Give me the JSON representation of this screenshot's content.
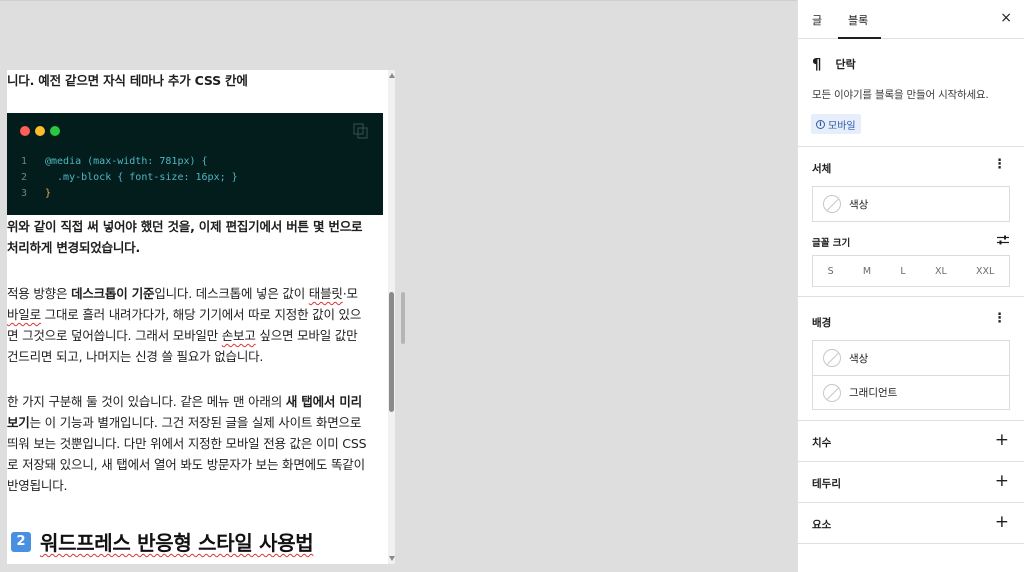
{
  "editor": {
    "line_top": "니다. 예전 같으면 자식 테마나 추가 CSS 칸에",
    "code": {
      "lines": [
        {
          "num": "1",
          "kw": "@media",
          "rest": " (max-width: 781px) {"
        },
        {
          "num": "2",
          "text": "  .my-block { font-size: 16px; }"
        },
        {
          "num": "3",
          "text": "}"
        }
      ]
    },
    "para1": {
      "line1": "위와 같이 직접 써 넣어야 했던 것을, 이제 편집기에서 버튼 몇 번으로",
      "line2": "처리하게 변경되었습니다."
    },
    "para2": {
      "l1_a": "적용 방향은 ",
      "l1_b": "데스크톱이 기준",
      "l1_c": "입니다. 데스크톱에 넣은 값이 ",
      "l1_d": "태블릿",
      "l1_e": "·모",
      "l2_a": "바일로",
      "l2_b": " 그대로 흘러 내려가다가, 해당 기기에서 따로 지정한 값이 있으",
      "l3": "면 그것으로 덮어씁니다. 그래서 모바일만 ",
      "l3_b": "손보고",
      "l3_c": " 싶으면 모바일 값만",
      "l4": "건드리면 되고, 나머지는 신경 쓸 필요가 없습니다."
    },
    "para3": {
      "l1_a": "한 가지 구분해 둘 것이 있습니다. 같은 메뉴 맨 아래의 ",
      "l1_b": "새 탭에서 미리",
      "l2_a": "보기",
      "l2_b": "는 이 기능과 별개입니다. 그건 저장된 글을 실제 사이트 화면으로",
      "l3": "띄워 보는 것뿐입니다. 다만 위에서 지정한 모바일 전용 값은 이미 CSS",
      "l4": "로 저장돼 있으니, 새 탭에서 열어 봐도 방문자가 보는 화면에도 똑같이",
      "l5": "반영됩니다."
    },
    "heading": {
      "number": "2",
      "text": "워드프레스 반응형 스타일 사용법"
    }
  },
  "sidebar": {
    "tabs": [
      "글",
      "블록"
    ],
    "active_tab": "블록",
    "close": "×",
    "block": {
      "icon": "¶",
      "title": "단락",
      "description": "모든 이야기를 블록을 만들어 시작하세요.",
      "badge": "모바일"
    },
    "typography": {
      "title": "서체",
      "color_label": "색상",
      "font_size_label": "글꼴 크기",
      "sizes": [
        "S",
        "M",
        "L",
        "XL",
        "XXL"
      ]
    },
    "background": {
      "title": "배경",
      "color_label": "색상",
      "gradient_label": "그래디언트"
    },
    "dimensions": {
      "title": "치수"
    },
    "border": {
      "title": "테두리"
    },
    "elements": {
      "title": "요소"
    }
  },
  "colors": {
    "code_bg": "#031d1c",
    "dot_red": "#ff5f57",
    "dot_yellow": "#febc2e",
    "dot_green": "#28c840",
    "accent_blue": "#4a90e2"
  }
}
